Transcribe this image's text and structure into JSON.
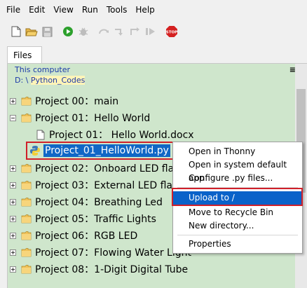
{
  "menubar": {
    "items": [
      "File",
      "Edit",
      "View",
      "Run",
      "Tools",
      "Help"
    ]
  },
  "toolbar": {
    "buttons": [
      "new-file",
      "open-file",
      "save-file",
      "run",
      "debug",
      "step-over",
      "step-into",
      "step-out",
      "resume",
      "stop"
    ],
    "stop_label": "STOP"
  },
  "files_tab": {
    "label": "Files",
    "close": "×"
  },
  "file_panel": {
    "location_label": "This computer",
    "path_prefix": "D: \\ ",
    "path_highlight": "Python_Codes",
    "menu_icon": "≡",
    "tree": [
      {
        "label": "Project 00：main",
        "type": "folder",
        "expander": "plus"
      },
      {
        "label": "Project 01：Hello World",
        "type": "folder",
        "expander": "minus"
      },
      {
        "label": "Project 01：  Hello World.docx",
        "type": "docx"
      },
      {
        "label": "Project_01_HelloWorld.py",
        "type": "py",
        "selected": true
      },
      {
        "label": "Project 02：Onboard LED flash",
        "type": "folder",
        "expander": "plus"
      },
      {
        "label": "Project 03：External LED flashing",
        "type": "folder",
        "expander": "plus"
      },
      {
        "label": "Project 04：Breathing Led",
        "type": "folder",
        "expander": "plus"
      },
      {
        "label": "Project 05：Traffic Lights",
        "type": "folder",
        "expander": "plus"
      },
      {
        "label": "Project 06：RGB LED",
        "type": "folder",
        "expander": "plus"
      },
      {
        "label": "Project 07：Flowing Water Light",
        "type": "folder",
        "expander": "plus"
      },
      {
        "label": "Project 08：1-Digit Digital Tube",
        "type": "folder",
        "expander": "plus"
      }
    ]
  },
  "context_menu": {
    "items": [
      "Open in Thonny",
      "Open in system default app",
      "Configure .py files...",
      "Upload to /",
      "Move to Recycle Bin",
      "New directory...",
      "Properties"
    ],
    "active_item": "Upload to /"
  },
  "colors": {
    "panel_bg": "#cfe6cc",
    "selection": "#1067c6",
    "highlight_box": "#d0202a",
    "path_text": "#1c3aa8"
  }
}
